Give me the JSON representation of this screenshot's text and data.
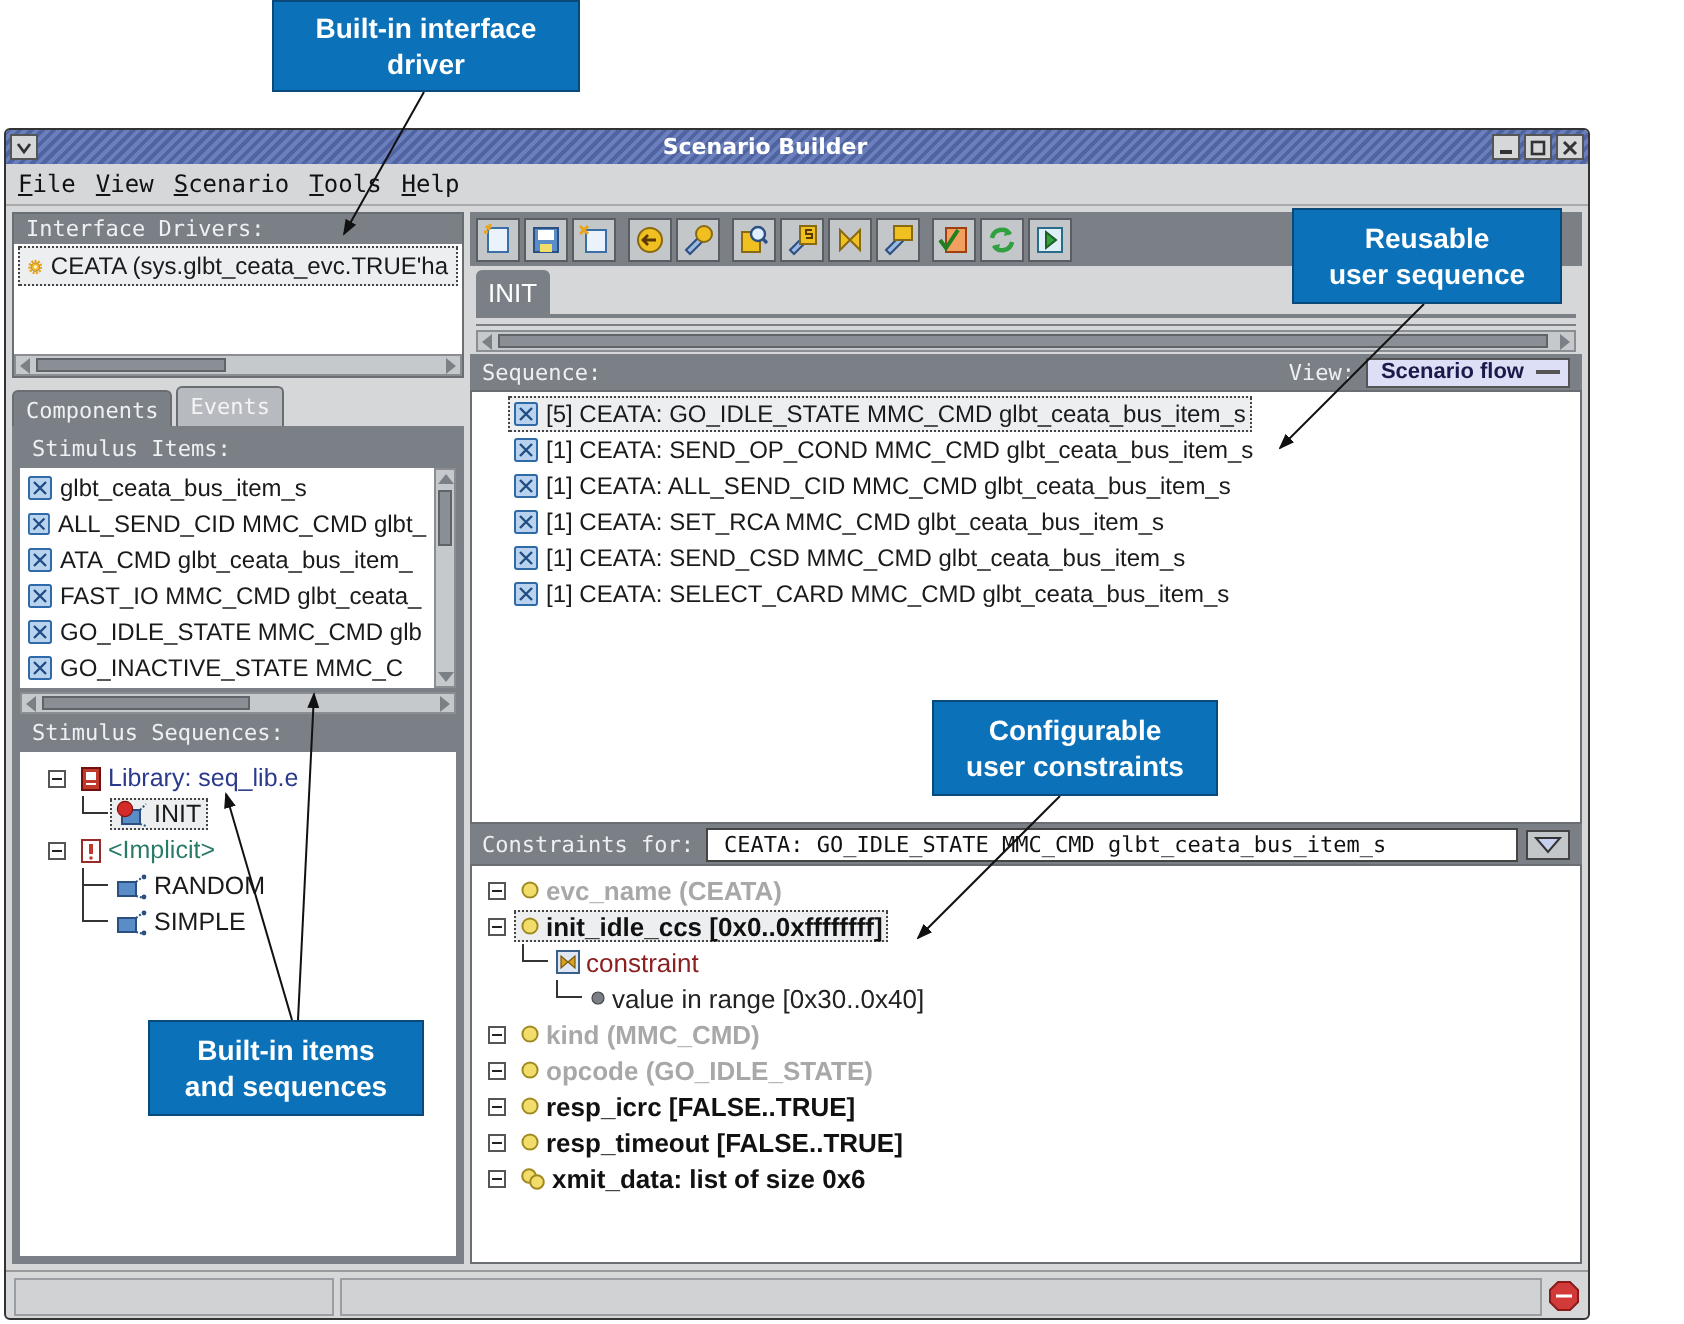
{
  "callouts": [
    {
      "text": "Built-in interface\ndriver"
    },
    {
      "text": "Reusable\nuser sequence"
    },
    {
      "text": "Configurable\nuser constraints"
    },
    {
      "text": "Built-in items\nand sequences"
    }
  ],
  "window": {
    "title": "Scenario Builder"
  },
  "menu": [
    "File",
    "View",
    "Scenario",
    "Tools",
    "Help"
  ],
  "interface_drivers": {
    "title": "Interface Drivers:",
    "items": [
      {
        "label": "CEATA (sys.glbt_ceata_evc.TRUE'ha",
        "selected": true
      }
    ]
  },
  "left_tabs": [
    {
      "label": "Components",
      "selected": true
    },
    {
      "label": "Events",
      "selected": false
    }
  ],
  "stimulus_items": {
    "title": "Stimulus Items:",
    "items": [
      {
        "label": "glbt_ceata_bus_item_s",
        "selected": false
      },
      {
        "label": "ALL_SEND_CID MMC_CMD glbt_",
        "selected": false
      },
      {
        "label": "ATA_CMD glbt_ceata_bus_item_",
        "selected": false
      },
      {
        "label": "FAST_IO MMC_CMD glbt_ceata_",
        "selected": false
      },
      {
        "label": "GO_IDLE_STATE MMC_CMD glb",
        "selected": false
      },
      {
        "label": "GO_INACTIVE_STATE MMC_C",
        "selected": false
      }
    ]
  },
  "stimulus_sequences": {
    "title": "Stimulus Sequences:",
    "tree": [
      {
        "label": "Library: seq_lib.e",
        "kind": "library",
        "expanded": true,
        "selected": false,
        "children": [
          {
            "label": "INIT",
            "kind": "user_sequence",
            "selected": true
          }
        ]
      },
      {
        "label": "<Implicit>",
        "kind": "implicit",
        "expanded": true,
        "selected": false,
        "children": [
          {
            "label": "RANDOM",
            "kind": "sequence",
            "selected": false
          },
          {
            "label": "SIMPLE",
            "kind": "sequence",
            "selected": false
          }
        ]
      }
    ]
  },
  "tabs": [
    {
      "label": "INIT",
      "selected": true
    }
  ],
  "sequence": {
    "title": "Sequence:",
    "view_label": "View:",
    "view_value": "Scenario flow",
    "items": [
      {
        "label": "[5] CEATA: GO_IDLE_STATE MMC_CMD glbt_ceata_bus_item_s",
        "selected": true
      },
      {
        "label": "[1] CEATA: SEND_OP_COND MMC_CMD glbt_ceata_bus_item_s",
        "selected": false
      },
      {
        "label": "[1] CEATA: ALL_SEND_CID MMC_CMD glbt_ceata_bus_item_s",
        "selected": false
      },
      {
        "label": "[1] CEATA: SET_RCA MMC_CMD glbt_ceata_bus_item_s",
        "selected": false
      },
      {
        "label": "[1] CEATA: SEND_CSD MMC_CMD glbt_ceata_bus_item_s",
        "selected": false
      },
      {
        "label": "[1] CEATA: SELECT_CARD MMC_CMD glbt_ceata_bus_item_s",
        "selected": false
      }
    ]
  },
  "constraints": {
    "title": "Constraints for:",
    "value": "CEATA: GO_IDLE_STATE MMC_CMD glbt_ceata_bus_item_s",
    "tree": [
      {
        "label": "evc_name (CEATA)",
        "kind": "field",
        "expanded": true,
        "disabled": true,
        "selected": false
      },
      {
        "label": "init_idle_ccs [0x0..0xffffffff]",
        "kind": "field",
        "expanded": true,
        "disabled": false,
        "selected": true,
        "children": [
          {
            "label": "constraint",
            "kind": "constraint",
            "selected": false,
            "children": [
              {
                "label": "value in range [0x30..0x40]",
                "kind": "value",
                "selected": false
              }
            ]
          }
        ]
      },
      {
        "label": "kind (MMC_CMD)",
        "kind": "field",
        "expanded": true,
        "disabled": true,
        "selected": false
      },
      {
        "label": "opcode (GO_IDLE_STATE)",
        "kind": "field",
        "expanded": true,
        "disabled": true,
        "selected": false
      },
      {
        "label": "resp_icrc [FALSE..TRUE]",
        "kind": "field",
        "expanded": true,
        "disabled": false,
        "selected": false
      },
      {
        "label": "resp_timeout [FALSE..TRUE]",
        "kind": "field",
        "expanded": true,
        "disabled": false,
        "selected": false
      },
      {
        "label": "xmit_data: list of size 0x6",
        "kind": "list",
        "expanded": true,
        "disabled": false,
        "selected": false
      }
    ]
  }
}
